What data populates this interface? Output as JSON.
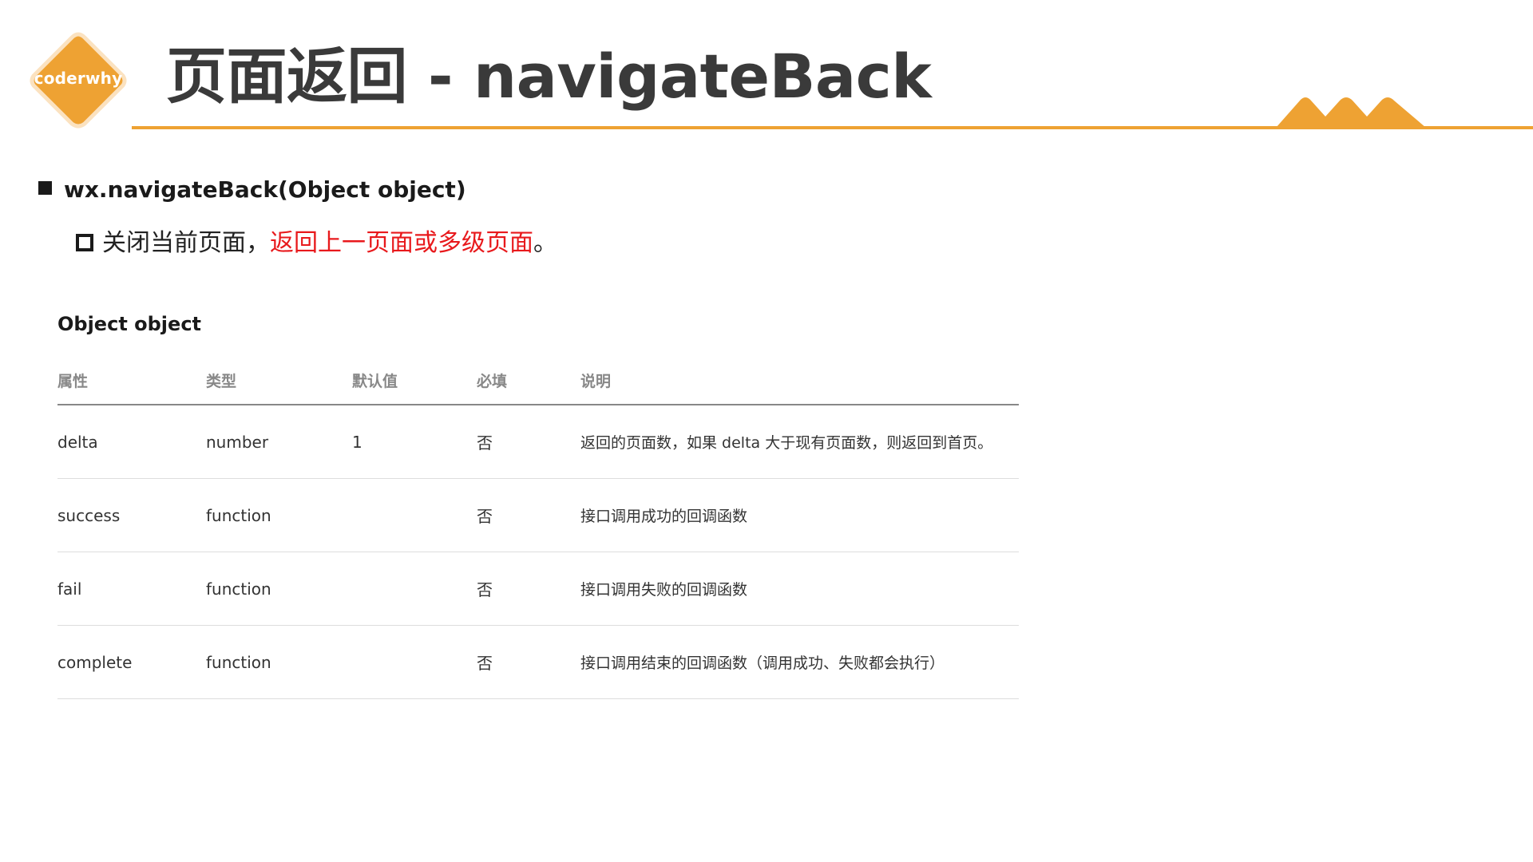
{
  "header": {
    "logo_text": "coderwhy",
    "title": "页面返回 - navigateBack",
    "colors": {
      "accent": "#eea233",
      "title": "#3a3a3a",
      "highlight": "#e8191c"
    }
  },
  "content": {
    "api_signature": "wx.navigateBack(Object object)",
    "description_prefix": "关闭当前页面，",
    "description_highlight": "返回上一页面或多级页面",
    "description_suffix": "。"
  },
  "table": {
    "heading": "Object object",
    "columns": [
      "属性",
      "类型",
      "默认值",
      "必填",
      "说明"
    ],
    "rows": [
      {
        "prop": "delta",
        "type": "number",
        "default": "1",
        "required": "否",
        "desc": "返回的页面数，如果 delta 大于现有页面数，则返回到首页。"
      },
      {
        "prop": "success",
        "type": "function",
        "default": "",
        "required": "否",
        "desc": "接口调用成功的回调函数"
      },
      {
        "prop": "fail",
        "type": "function",
        "default": "",
        "required": "否",
        "desc": "接口调用失败的回调函数"
      },
      {
        "prop": "complete",
        "type": "function",
        "default": "",
        "required": "否",
        "desc": "接口调用结束的回调函数（调用成功、失败都会执行）"
      }
    ]
  },
  "icons": {
    "logo": "diamond-logo-icon",
    "decoration": "mountain-peaks-icon",
    "bullet_primary": "filled-square-bullet-icon",
    "bullet_secondary": "hollow-square-bullet-icon"
  }
}
